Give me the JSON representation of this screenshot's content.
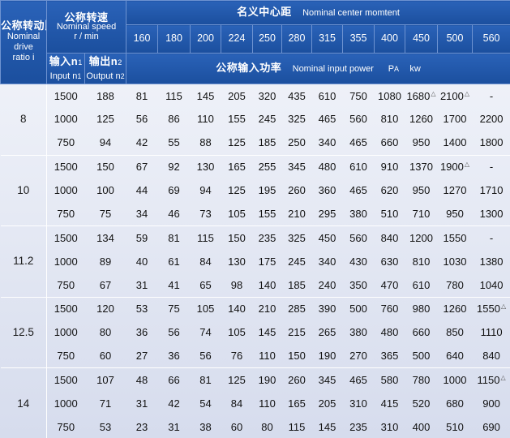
{
  "header": {
    "ratio_zh": "公称转动比i",
    "ratio_en_1": "Nominal",
    "ratio_en_2": "drive",
    "ratio_en_3": "ratio i",
    "speed_zh": "公称转速",
    "speed_en": "Nominal speed",
    "speed_unit": "r / min",
    "center_zh": "名义中心距",
    "center_en": "Nominal center momtent",
    "center_distances": [
      "160",
      "180",
      "200",
      "224",
      "250",
      "280",
      "315",
      "355",
      "400",
      "450",
      "500",
      "560"
    ],
    "input_zh": "输入n",
    "input_sub": "1",
    "input_en": "Input n",
    "output_zh": "输出n",
    "output_sub": "2",
    "output_en": "Output n",
    "power_zh": "公称输入功率",
    "power_en": "Nominal input power",
    "power_sym": "P",
    "power_sub": "A",
    "power_unit": "kw"
  },
  "groups": [
    {
      "ratio": "8",
      "rows": [
        {
          "input": "1500",
          "output": "188",
          "values": [
            "81",
            "115",
            "145",
            "205",
            "320",
            "435",
            "610",
            "750",
            "1080",
            "1680",
            "2100",
            "-"
          ],
          "flags": [
            false,
            false,
            false,
            false,
            false,
            false,
            false,
            false,
            false,
            true,
            true,
            false
          ]
        },
        {
          "input": "1000",
          "output": "125",
          "values": [
            "56",
            "86",
            "110",
            "155",
            "245",
            "325",
            "465",
            "560",
            "810",
            "1260",
            "1700",
            "2200"
          ],
          "flags": [
            false,
            false,
            false,
            false,
            false,
            false,
            false,
            false,
            false,
            false,
            false,
            false
          ]
        },
        {
          "input": "750",
          "output": "94",
          "values": [
            "42",
            "55",
            "88",
            "125",
            "185",
            "250",
            "340",
            "465",
            "660",
            "950",
            "1400",
            "1800"
          ],
          "flags": [
            false,
            false,
            false,
            false,
            false,
            false,
            false,
            false,
            false,
            false,
            false,
            false
          ]
        }
      ]
    },
    {
      "ratio": "10",
      "rows": [
        {
          "input": "1500",
          "output": "150",
          "values": [
            "67",
            "92",
            "130",
            "165",
            "255",
            "345",
            "480",
            "610",
            "910",
            "1370",
            "1900",
            "-"
          ],
          "flags": [
            false,
            false,
            false,
            false,
            false,
            false,
            false,
            false,
            false,
            false,
            true,
            false
          ]
        },
        {
          "input": "1000",
          "output": "100",
          "values": [
            "44",
            "69",
            "94",
            "125",
            "195",
            "260",
            "360",
            "465",
            "620",
            "950",
            "1270",
            "1710"
          ],
          "flags": [
            false,
            false,
            false,
            false,
            false,
            false,
            false,
            false,
            false,
            false,
            false,
            false
          ]
        },
        {
          "input": "750",
          "output": "75",
          "values": [
            "34",
            "46",
            "73",
            "105",
            "155",
            "210",
            "295",
            "380",
            "510",
            "710",
            "950",
            "1300"
          ],
          "flags": [
            false,
            false,
            false,
            false,
            false,
            false,
            false,
            false,
            false,
            false,
            false,
            false
          ]
        }
      ]
    },
    {
      "ratio": "11.2",
      "rows": [
        {
          "input": "1500",
          "output": "134",
          "values": [
            "59",
            "81",
            "115",
            "150",
            "235",
            "325",
            "450",
            "560",
            "840",
            "1200",
            "1550",
            "-"
          ],
          "flags": [
            false,
            false,
            false,
            false,
            false,
            false,
            false,
            false,
            false,
            false,
            false,
            false
          ]
        },
        {
          "input": "1000",
          "output": "89",
          "values": [
            "40",
            "61",
            "84",
            "130",
            "175",
            "245",
            "340",
            "430",
            "630",
            "810",
            "1030",
            "1380"
          ],
          "flags": [
            false,
            false,
            false,
            false,
            false,
            false,
            false,
            false,
            false,
            false,
            false,
            false
          ]
        },
        {
          "input": "750",
          "output": "67",
          "values": [
            "31",
            "41",
            "65",
            "98",
            "140",
            "185",
            "240",
            "350",
            "470",
            "610",
            "780",
            "1040"
          ],
          "flags": [
            false,
            false,
            false,
            false,
            false,
            false,
            false,
            false,
            false,
            false,
            false,
            false
          ]
        }
      ]
    },
    {
      "ratio": "12.5",
      "rows": [
        {
          "input": "1500",
          "output": "120",
          "values": [
            "53",
            "75",
            "105",
            "140",
            "210",
            "285",
            "390",
            "500",
            "760",
            "980",
            "1260",
            "1550"
          ],
          "flags": [
            false,
            false,
            false,
            false,
            false,
            false,
            false,
            false,
            false,
            false,
            false,
            true
          ]
        },
        {
          "input": "1000",
          "output": "80",
          "values": [
            "36",
            "56",
            "74",
            "105",
            "145",
            "215",
            "265",
            "380",
            "480",
            "660",
            "850",
            "1110"
          ],
          "flags": [
            false,
            false,
            false,
            false,
            false,
            false,
            false,
            false,
            false,
            false,
            false,
            false
          ]
        },
        {
          "input": "750",
          "output": "60",
          "values": [
            "27",
            "36",
            "56",
            "76",
            "110",
            "150",
            "190",
            "270",
            "365",
            "500",
            "640",
            "840"
          ],
          "flags": [
            false,
            false,
            false,
            false,
            false,
            false,
            false,
            false,
            false,
            false,
            false,
            false
          ]
        }
      ]
    },
    {
      "ratio": "14",
      "rows": [
        {
          "input": "1500",
          "output": "107",
          "values": [
            "48",
            "66",
            "81",
            "125",
            "190",
            "260",
            "345",
            "465",
            "580",
            "780",
            "1000",
            "1150"
          ],
          "flags": [
            false,
            false,
            false,
            false,
            false,
            false,
            false,
            false,
            false,
            false,
            false,
            true
          ]
        },
        {
          "input": "1000",
          "output": "71",
          "values": [
            "31",
            "42",
            "54",
            "84",
            "110",
            "165",
            "205",
            "310",
            "415",
            "520",
            "680",
            "900"
          ],
          "flags": [
            false,
            false,
            false,
            false,
            false,
            false,
            false,
            false,
            false,
            false,
            false,
            false
          ]
        },
        {
          "input": "750",
          "output": "53",
          "values": [
            "23",
            "31",
            "38",
            "60",
            "80",
            "115",
            "145",
            "235",
            "310",
            "400",
            "510",
            "690"
          ],
          "flags": [
            false,
            false,
            false,
            false,
            false,
            false,
            false,
            false,
            false,
            false,
            false,
            false
          ]
        }
      ]
    }
  ],
  "flag_symbol": "△"
}
